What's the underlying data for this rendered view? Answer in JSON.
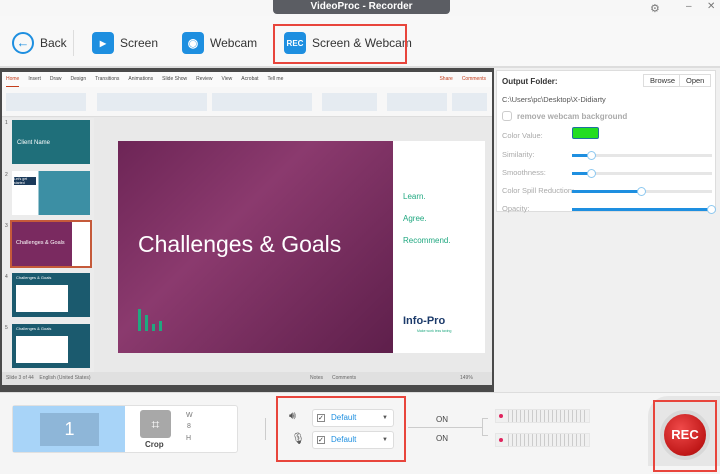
{
  "window": {
    "title": "VideoProc - Recorder",
    "settings_icon": "gear-icon",
    "minimize": "–",
    "close": "✕"
  },
  "toolbar": {
    "back": "Back",
    "screen": "Screen",
    "webcam": "Webcam",
    "screen_webcam": "Screen & Webcam",
    "rec_badge": "REC"
  },
  "ppt": {
    "tabs": [
      "Home",
      "Insert",
      "Draw",
      "Design",
      "Transitions",
      "Animations",
      "Slide Show",
      "Review",
      "View",
      "Acrobat",
      "Tell me"
    ],
    "share": "Share",
    "comments": "Comments",
    "thumb_numbers": [
      "1",
      "2",
      "3",
      "4",
      "5"
    ],
    "thumb_texts": [
      "Client Name",
      "Let's get started",
      "Challenges & Goals",
      "Challenges & Goals",
      "Challenges & Goals"
    ],
    "slide": {
      "title": "Challenges & Goals",
      "bullets": [
        "Learn.",
        "Agree.",
        "Recommend."
      ],
      "logo": "Info-Pro",
      "tagline": "Make work less taxing"
    },
    "status_left": "Slide 3 of 44",
    "status_lang": "English (United States)",
    "status_notes": "Notes",
    "status_comments": "Comments",
    "zoom": "149%"
  },
  "settings": {
    "output_label": "Output Folder:",
    "browse": "Browse",
    "open": "Open",
    "path": "C:\\Users\\pc\\Desktop\\X-Didiarty",
    "remove_bg": "remove webcam background",
    "color_value": "Color Value:",
    "color": "#22dd22",
    "sliders": [
      {
        "label": "Similarity:",
        "value": 0.14
      },
      {
        "label": "Smoothness:",
        "value": 0.14
      },
      {
        "label": "Color Spill Reduction:",
        "value": 0.5
      },
      {
        "label": "Opacity:",
        "value": 1.0
      }
    ]
  },
  "bottom": {
    "screen_number": "1",
    "crop": "Crop",
    "w": "W",
    "h": "H",
    "speaker": "Default",
    "mic": "Default",
    "speaker_state": "ON",
    "mic_state": "ON",
    "rec": "REC"
  }
}
